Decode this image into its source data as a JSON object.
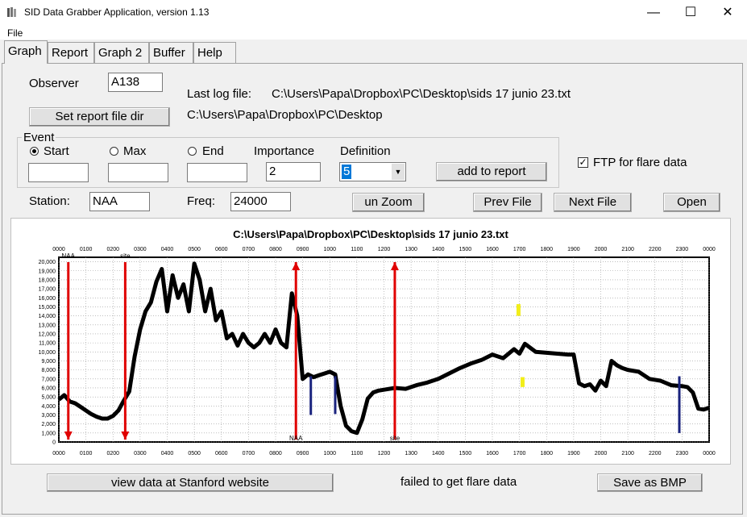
{
  "window": {
    "title": "SID Data Grabber Application, version 1.13",
    "minimize": "—",
    "maximize": "☐",
    "close": "✕"
  },
  "menu": {
    "file": "File"
  },
  "tabs": [
    "Graph",
    "Report",
    "Graph 2",
    "Buffer",
    "Help"
  ],
  "form": {
    "observer_label": "Observer",
    "observer_value": "A138",
    "last_log_label": "Last log file:",
    "last_log_value": "C:\\Users\\Papa\\Dropbox\\PC\\Desktop\\sids 17 junio 23.txt",
    "set_report_dir": "Set report file dir",
    "report_dir_value": "C:\\Users\\Papa\\Dropbox\\PC\\Desktop",
    "event_label": "Event",
    "start_label": "Start",
    "max_label": "Max",
    "end_label": "End",
    "importance_label": "Importance",
    "importance_value": "2",
    "definition_label": "Definition",
    "definition_value": "5",
    "add_to_report": "add to report",
    "ftp_label": "FTP for flare data",
    "station_label": "Station:",
    "station_value": "NAA",
    "freq_label": "Freq:",
    "freq_value": "24000",
    "unzoom": "un Zoom",
    "prev_file": "Prev File",
    "next_file": "Next File",
    "open": "Open",
    "view_stanford": "view data at Stanford website",
    "status": "failed to get flare data",
    "save_bmp": "Save as BMP"
  },
  "chart_data": {
    "type": "line",
    "title": "C:\\Users\\Papa\\Dropbox\\PC\\Desktop\\sids 17 junio 23.txt",
    "x_ticks": [
      "0000",
      "0100",
      "0200",
      "0300",
      "0400",
      "0500",
      "0600",
      "0700",
      "0800",
      "0900",
      "1000",
      "1100",
      "1200",
      "1300",
      "1400",
      "1500",
      "1600",
      "1700",
      "1800",
      "1900",
      "2000",
      "2100",
      "2200",
      "2300",
      "0000"
    ],
    "y_ticks": [
      "0",
      "1,000",
      "2,000",
      "3,000",
      "4,000",
      "5,000",
      "6,000",
      "7,000",
      "8,000",
      "9,000",
      "10,000",
      "11,000",
      "12,000",
      "13,000",
      "14,000",
      "15,000",
      "16,000",
      "17,000",
      "18,000",
      "19,000",
      "20,000"
    ],
    "ylim": [
      0,
      20500
    ],
    "xlim": [
      0,
      24
    ],
    "series": [
      {
        "x": [
          0,
          0.2,
          0.4,
          0.6,
          0.8,
          1.0,
          1.2,
          1.4,
          1.6,
          1.8,
          2.0,
          2.2,
          2.4,
          2.6,
          2.8,
          3.0,
          3.2,
          3.4,
          3.6,
          3.8,
          4.0,
          4.2,
          4.4,
          4.6,
          4.8,
          5.0,
          5.2,
          5.4,
          5.6,
          5.8,
          6.0,
          6.2,
          6.4,
          6.6,
          6.8,
          7.0,
          7.2,
          7.4,
          7.6,
          7.8,
          8.0,
          8.2,
          8.4,
          8.6,
          8.8,
          9.0,
          9.2,
          9.4,
          9.6,
          9.8,
          10.0,
          10.2,
          10.4,
          10.6,
          10.8,
          11.0,
          11.2,
          11.4,
          11.6,
          11.8,
          12.0,
          12.4,
          12.8,
          13.2,
          13.6,
          14.0,
          14.4,
          14.8,
          15.2,
          15.6,
          16.0,
          16.4,
          16.8,
          17.0,
          17.2,
          17.6,
          18.0,
          18.4,
          18.8,
          19.0,
          19.2,
          19.4,
          19.6,
          19.8,
          20.0,
          20.2,
          20.4,
          20.6,
          20.8,
          21.0,
          21.4,
          21.8,
          22.2,
          22.6,
          23.0,
          23.2,
          23.4,
          23.6,
          23.8,
          24.0
        ],
        "y": [
          4700,
          5200,
          4500,
          4300,
          3900,
          3500,
          3100,
          2800,
          2600,
          2600,
          2900,
          3500,
          4600,
          5600,
          9500,
          12500,
          14500,
          15500,
          17800,
          19200,
          14500,
          18500,
          16000,
          17500,
          14500,
          19800,
          18000,
          14500,
          17000,
          13500,
          14500,
          11500,
          12000,
          10700,
          12000,
          11000,
          10500,
          11000,
          12000,
          11000,
          12500,
          11000,
          10500,
          16500,
          14000,
          7000,
          7500,
          7200,
          7400,
          7600,
          7800,
          7500,
          4000,
          1800,
          1200,
          1000,
          2500,
          4800,
          5500,
          5700,
          5800,
          6000,
          5900,
          6300,
          6600,
          7000,
          7600,
          8200,
          8700,
          9100,
          9700,
          9300,
          10300,
          9800,
          10900,
          10000,
          9900,
          9800,
          9700,
          9700,
          6500,
          6200,
          6400,
          5700,
          6800,
          6200,
          9000,
          8500,
          8200,
          8000,
          7800,
          7000,
          6800,
          6300,
          6200,
          6100,
          5500,
          3700,
          3600,
          3800
        ]
      }
    ],
    "markers": [
      {
        "x": 0.35,
        "dir": "down",
        "label": "NAA"
      },
      {
        "x": 2.45,
        "dir": "down",
        "label": "site"
      },
      {
        "x": 8.75,
        "dir": "up",
        "label": "NAA"
      },
      {
        "x": 12.4,
        "dir": "up",
        "label": "site"
      }
    ],
    "grid": true,
    "accent_colors": {
      "line": "#000000",
      "marker": "#e00000",
      "highlight": "#f2ee1a",
      "dip": "#1a237e"
    }
  }
}
